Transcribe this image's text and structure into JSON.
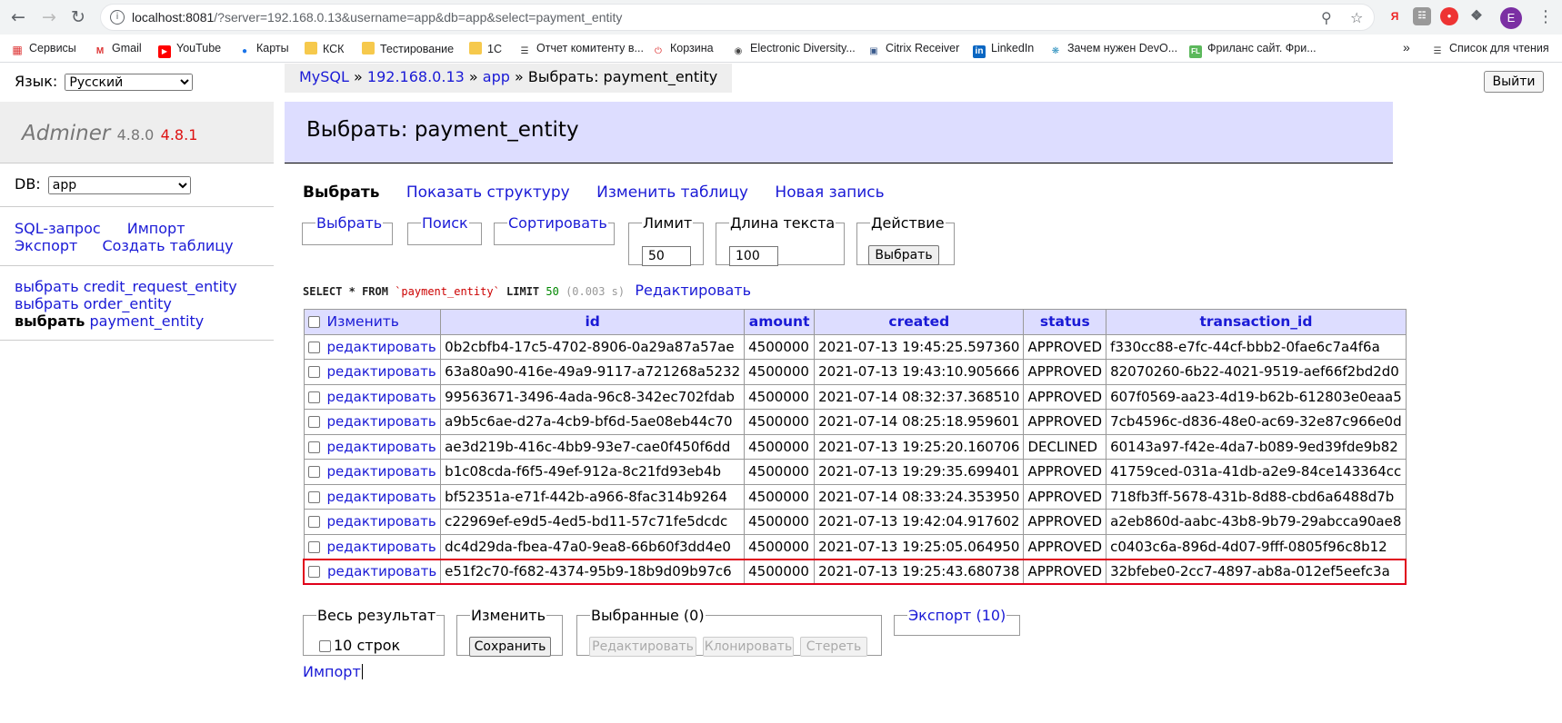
{
  "browser": {
    "url_host": "localhost:8081",
    "url_rest": "/?server=192.168.0.13&username=app&db=app&select=payment_entity",
    "bookmarks": [
      "Сервисы",
      "Gmail",
      "YouTube",
      "Карты",
      "КСК",
      "Тестирование",
      "1С",
      "Отчет комитенту в...",
      "Корзина",
      "Electronic Diversity...",
      "Citrix Receiver",
      "LinkedIn",
      "Зачем нужен DevO...",
      "Фриланс сайт. Фри..."
    ],
    "more": "»",
    "reading_list": "Список для чтения",
    "avatar_letter": "E",
    "ext_ya": "Я"
  },
  "sidebar": {
    "lang_label": "Язык:",
    "lang_value": "Русский",
    "app_name": "Adminer",
    "version": "4.8.0",
    "new_version": "4.8.1",
    "db_label": "DB:",
    "db_value": "app",
    "sql_link": "SQL-запрос",
    "import_link": "Импорт",
    "export_link": "Экспорт",
    "create_table_link": "Создать таблицу",
    "tables": [
      {
        "action": "выбрать",
        "name": "credit_request_entity"
      },
      {
        "action": "выбрать",
        "name": "order_entity"
      },
      {
        "action": "выбрать",
        "name": "payment_entity"
      }
    ]
  },
  "breadcrumb": {
    "mysql": "MySQL",
    "sep": "»",
    "server": "192.168.0.13",
    "db": "app",
    "current": "Выбрать: payment_entity"
  },
  "logout": "Выйти",
  "title": "Выбрать: payment_entity",
  "tabs": [
    "Выбрать",
    "Показать структуру",
    "Изменить таблицу",
    "Новая запись"
  ],
  "form": {
    "select_legend": "Выбрать",
    "search_legend": "Поиск",
    "sort_legend": "Сортировать",
    "limit_legend": "Лимит",
    "limit_value": "50",
    "textlen_legend": "Длина текста",
    "textlen_value": "100",
    "action_legend": "Действие",
    "action_button": "Выбрать"
  },
  "query": {
    "select": "SELECT",
    "star": "*",
    "from": "FROM",
    "table": "`payment_entity`",
    "limit": "LIMIT",
    "limit_value": "50",
    "time": "(0.003 s)",
    "edit": "Редактировать"
  },
  "grid": {
    "modify_header": "Изменить",
    "columns": [
      "id",
      "amount",
      "created",
      "status",
      "transaction_id"
    ],
    "edit_label": "редактировать",
    "rows": [
      [
        "0b2cbfb4-17c5-4702-8906-0a29a87a57ae",
        "4500000",
        "2021-07-13 19:45:25.597360",
        "APPROVED",
        "f330cc88-e7fc-44cf-bbb2-0fae6c7a4f6a"
      ],
      [
        "63a80a90-416e-49a9-9117-a721268a5232",
        "4500000",
        "2021-07-13 19:43:10.905666",
        "APPROVED",
        "82070260-6b22-4021-9519-aef66f2bd2d0"
      ],
      [
        "99563671-3496-4ada-96c8-342ec702fdab",
        "4500000",
        "2021-07-14 08:32:37.368510",
        "APPROVED",
        "607f0569-aa23-4d19-b62b-612803e0eaa5"
      ],
      [
        "a9b5c6ae-d27a-4cb9-bf6d-5ae08eb44c70",
        "4500000",
        "2021-07-14 08:25:18.959601",
        "APPROVED",
        "7cb4596c-d836-48e0-ac69-32e87c966e0d"
      ],
      [
        "ae3d219b-416c-4bb9-93e7-cae0f450f6dd",
        "4500000",
        "2021-07-13 19:25:20.160706",
        "DECLINED",
        "60143a97-f42e-4da7-b089-9ed39fde9b82"
      ],
      [
        "b1c08cda-f6f5-49ef-912a-8c21fd93eb4b",
        "4500000",
        "2021-07-13 19:29:35.699401",
        "APPROVED",
        "41759ced-031a-41db-a2e9-84ce143364cc"
      ],
      [
        "bf52351a-e71f-442b-a966-8fac314b9264",
        "4500000",
        "2021-07-14 08:33:24.353950",
        "APPROVED",
        "718fb3ff-5678-431b-8d88-cbd6a6488d7b"
      ],
      [
        "c22969ef-e9d5-4ed5-bd11-57c71fe5dcdc",
        "4500000",
        "2021-07-13 19:42:04.917602",
        "APPROVED",
        "a2eb860d-aabc-43b8-9b79-29abcca90ae8"
      ],
      [
        "dc4d29da-fbea-47a0-9ea8-66b60f3dd4e0",
        "4500000",
        "2021-07-13 19:25:05.064950",
        "APPROVED",
        "c0403c6a-896d-4d07-9fff-0805f96c8b12"
      ],
      [
        "e51f2c70-f682-4374-95b9-18b9d09b97c6",
        "4500000",
        "2021-07-13 19:25:43.680738",
        "APPROVED",
        "32bfebe0-2cc7-4897-ab8a-012ef5eefc3a"
      ]
    ],
    "highlight_color": "#e0001a"
  },
  "bottom": {
    "whole_legend": "Весь результат",
    "rows_count": "10 строк",
    "modify_legend": "Изменить",
    "save_button": "Сохранить",
    "selected_legend": "Выбранные (0)",
    "edit_button": "Редактировать",
    "clone_button": "Клонировать",
    "delete_button": "Стереть",
    "export_legend": "Экспорт (10)",
    "import_link": "Импорт"
  }
}
